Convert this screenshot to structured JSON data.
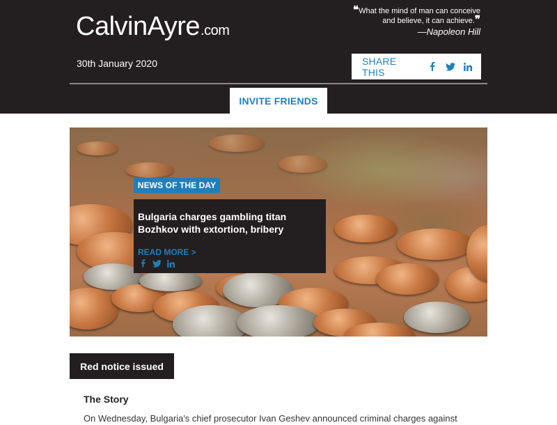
{
  "header": {
    "logo": {
      "name": "CalvinAyre",
      "suffix": ".com"
    },
    "quote": {
      "text_line1": "What the mind of man can conceive",
      "text_line2": "and believe, it can achieve.",
      "author": "—Napoleon Hill"
    },
    "date": "30th January 2020",
    "share": {
      "label": "SHARE THIS",
      "icons": [
        "facebook-icon",
        "twitter-icon",
        "linkedin-icon"
      ]
    },
    "invite_label": "INVITE FRIENDS"
  },
  "hero": {
    "badge": "NEWS OF THE DAY",
    "title": "Bulgaria charges gambling titan Bozhkov with extortion, bribery",
    "read_more": "READ MORE >"
  },
  "section": {
    "tab_label": "Red notice issued",
    "heading": "The Story",
    "text": "On Wednesday, Bulgaria's chief prosecutor Ivan Geshev announced criminal charges against"
  },
  "colors": {
    "dark": "#231f20",
    "accent": "#1f7fbd",
    "white": "#ffffff"
  }
}
